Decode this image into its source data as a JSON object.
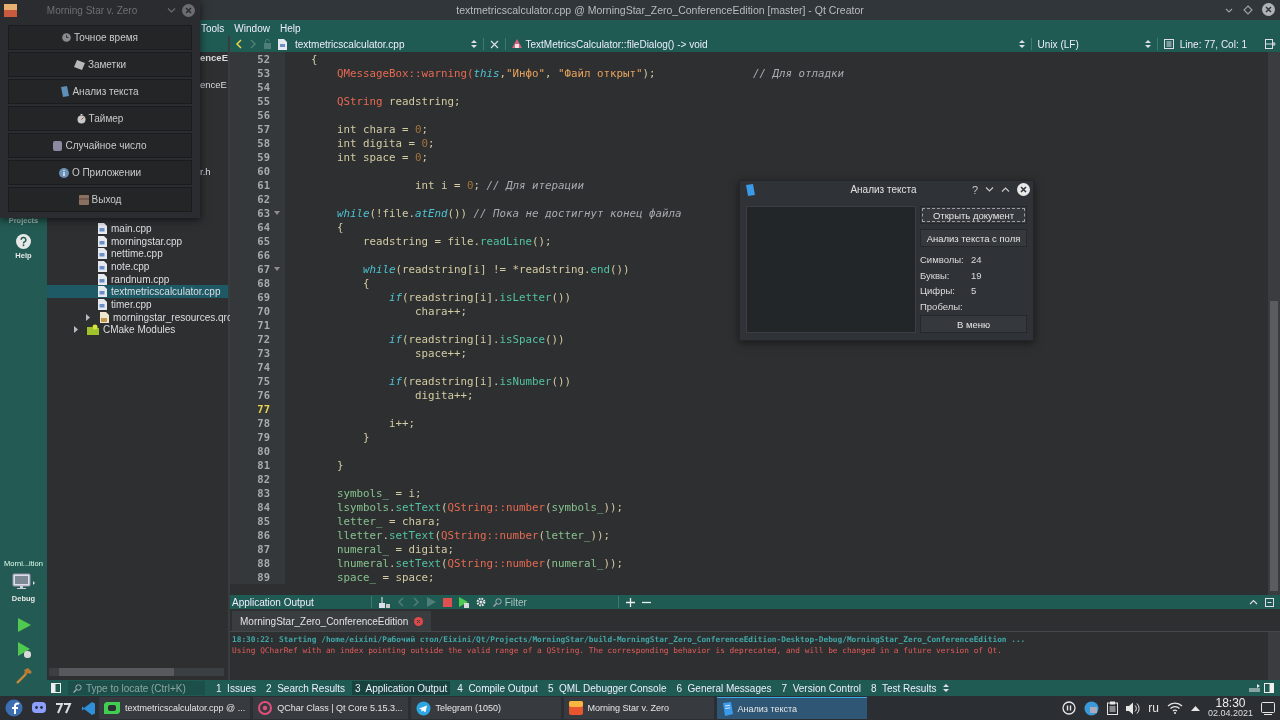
{
  "qt_window": {
    "title": "textmetricscalculator.cpp @ MorningStar_Zero_ConferenceEdition [master] - Qt Creator",
    "menu": [
      {
        "label": "Tools"
      },
      {
        "label": "Window"
      },
      {
        "label": "Help"
      }
    ]
  },
  "editor_toolbar": {
    "file": "textmetricscalculator.cpp",
    "symbol": "TextMetricsCalculator::fileDialog() -> void",
    "line_ending": "Unix (LF)",
    "position": "Line: 77, Col: 1"
  },
  "mode_bar": {
    "modes": [
      {
        "label": "Projects",
        "kind": "projects"
      },
      {
        "label": "Help",
        "kind": "help"
      }
    ],
    "project": "Morni...ition",
    "build": "Debug"
  },
  "project_tree": {
    "fragments": [
      {
        "text": "enceE",
        "kind": "project"
      },
      {
        "text": "enceE",
        "kind": "folder"
      },
      {
        "text": "r.h",
        "kind": "file"
      }
    ],
    "items": [
      {
        "label": "main.cpp",
        "kind": "file",
        "selected": false
      },
      {
        "label": "morningstar.cpp",
        "kind": "file",
        "selected": false
      },
      {
        "label": "nettime.cpp",
        "kind": "file",
        "selected": false
      },
      {
        "label": "note.cpp",
        "kind": "file",
        "selected": false
      },
      {
        "label": "randnum.cpp",
        "kind": "file",
        "selected": false
      },
      {
        "label": "textmetricscalculator.cpp",
        "kind": "file",
        "selected": true
      },
      {
        "label": "timer.cpp",
        "kind": "file",
        "selected": false
      },
      {
        "label": "morningstar_resources.qrc",
        "kind": "resource",
        "selected": false
      },
      {
        "label": "CMake Modules",
        "kind": "cmake",
        "selected": false
      }
    ]
  },
  "code": {
    "lines": [
      {
        "number": "52",
        "current": false,
        "foldable": false,
        "tokens": [
          {
            "kind": "plain",
            "text": "    {"
          }
        ]
      },
      {
        "number": "53",
        "current": false,
        "foldable": false,
        "tokens": [
          {
            "kind": "type",
            "text": "        QMessageBox::warning("
          },
          {
            "kind": "kw",
            "text": "this"
          },
          {
            "kind": "plain",
            "text": ","
          },
          {
            "kind": "str",
            "text": "\"Инфо\""
          },
          {
            "kind": "plain",
            "text": ", "
          },
          {
            "kind": "str",
            "text": "\"Файл открыт\""
          },
          {
            "kind": "plain",
            "text": ");               "
          },
          {
            "kind": "comment",
            "text": "// Для отладки"
          }
        ]
      },
      {
        "number": "54",
        "current": false,
        "foldable": false
      },
      {
        "number": "55",
        "current": false,
        "foldable": false,
        "tokens": [
          {
            "kind": "type",
            "text": "        QString"
          },
          {
            "kind": "plain",
            "text": " readstring;"
          }
        ]
      },
      {
        "number": "56",
        "current": false,
        "foldable": false
      },
      {
        "number": "57",
        "current": false,
        "foldable": false,
        "tokens": [
          {
            "kind": "plain",
            "text": "        int chara = "
          },
          {
            "kind": "num",
            "text": "0"
          },
          {
            "kind": "plain",
            "text": ";"
          }
        ]
      },
      {
        "number": "58",
        "current": false,
        "foldable": false,
        "tokens": [
          {
            "kind": "plain",
            "text": "        int digita = "
          },
          {
            "kind": "num",
            "text": "0"
          },
          {
            "kind": "plain",
            "text": ";"
          }
        ]
      },
      {
        "number": "59",
        "current": false,
        "foldable": false,
        "tokens": [
          {
            "kind": "plain",
            "text": "        int space = "
          },
          {
            "kind": "num",
            "text": "0"
          },
          {
            "kind": "plain",
            "text": ";"
          }
        ]
      },
      {
        "number": "60",
        "current": false,
        "foldable": false
      },
      {
        "number": "61",
        "current": false,
        "foldable": false,
        "tokens": [
          {
            "kind": "plain",
            "text": "                    int i = "
          },
          {
            "kind": "num",
            "text": "0"
          },
          {
            "kind": "plain",
            "text": "; "
          },
          {
            "kind": "comment",
            "text": "// Для итерации"
          }
        ]
      },
      {
        "number": "62",
        "current": false,
        "foldable": false
      },
      {
        "number": "63",
        "current": false,
        "foldable": true,
        "tokens": [
          {
            "kind": "kw",
            "text": "        while"
          },
          {
            "kind": "plain",
            "text": "(!file."
          },
          {
            "kind": "kw",
            "text": "atEnd"
          },
          {
            "kind": "plain",
            "text": "()) "
          },
          {
            "kind": "comment",
            "text": "// Пока не достигнут конец файла"
          }
        ]
      },
      {
        "number": "64",
        "current": false,
        "foldable": false,
        "tokens": [
          {
            "kind": "plain",
            "text": "        {"
          }
        ]
      },
      {
        "number": "65",
        "current": false,
        "foldable": false,
        "tokens": [
          {
            "kind": "plain",
            "text": "            readstring = file."
          },
          {
            "kind": "fn",
            "text": "readLine"
          },
          {
            "kind": "plain",
            "text": "();"
          }
        ]
      },
      {
        "number": "66",
        "current": false,
        "foldable": false
      },
      {
        "number": "67",
        "current": false,
        "foldable": true,
        "tokens": [
          {
            "kind": "kw",
            "text": "            while"
          },
          {
            "kind": "plain",
            "text": "(readstring[i] != *readstring."
          },
          {
            "kind": "fn",
            "text": "end"
          },
          {
            "kind": "plain",
            "text": "())"
          }
        ]
      },
      {
        "number": "68",
        "current": false,
        "foldable": false,
        "tokens": [
          {
            "kind": "plain",
            "text": "            {"
          }
        ]
      },
      {
        "number": "69",
        "current": false,
        "foldable": false,
        "tokens": [
          {
            "kind": "kw",
            "text": "                if"
          },
          {
            "kind": "plain",
            "text": "(readstring[i]."
          },
          {
            "kind": "fn",
            "text": "isLetter"
          },
          {
            "kind": "plain",
            "text": "())"
          }
        ]
      },
      {
        "number": "70",
        "current": false,
        "foldable": false,
        "tokens": [
          {
            "kind": "plain",
            "text": "                    chara++;"
          }
        ]
      },
      {
        "number": "71",
        "current": false,
        "foldable": false
      },
      {
        "number": "72",
        "current": false,
        "foldable": false,
        "tokens": [
          {
            "kind": "kw",
            "text": "                if"
          },
          {
            "kind": "plain",
            "text": "(readstring[i]."
          },
          {
            "kind": "fn",
            "text": "isSpace"
          },
          {
            "kind": "plain",
            "text": "())"
          }
        ]
      },
      {
        "number": "73",
        "current": false,
        "foldable": false,
        "tokens": [
          {
            "kind": "plain",
            "text": "                    space++;"
          }
        ]
      },
      {
        "number": "74",
        "current": false,
        "foldable": false
      },
      {
        "number": "75",
        "current": false,
        "foldable": false,
        "tokens": [
          {
            "kind": "kw",
            "text": "                if"
          },
          {
            "kind": "plain",
            "text": "(readstring[i]."
          },
          {
            "kind": "fn",
            "text": "isNumber"
          },
          {
            "kind": "plain",
            "text": "())"
          }
        ]
      },
      {
        "number": "76",
        "current": false,
        "foldable": false,
        "tokens": [
          {
            "kind": "plain",
            "text": "                    digita++;"
          }
        ]
      },
      {
        "number": "77",
        "current": true,
        "foldable": false
      },
      {
        "number": "78",
        "current": false,
        "foldable": false,
        "tokens": [
          {
            "kind": "plain",
            "text": "                i++;"
          }
        ]
      },
      {
        "number": "79",
        "current": false,
        "foldable": false,
        "tokens": [
          {
            "kind": "plain",
            "text": "            }"
          }
        ]
      },
      {
        "number": "80",
        "current": false,
        "foldable": false
      },
      {
        "number": "81",
        "current": false,
        "foldable": false,
        "tokens": [
          {
            "kind": "plain",
            "text": "        }"
          }
        ]
      },
      {
        "number": "82",
        "current": false,
        "foldable": false
      },
      {
        "number": "83",
        "current": false,
        "foldable": false,
        "tokens": [
          {
            "kind": "member",
            "text": "        symbols_"
          },
          {
            "kind": "plain",
            "text": " = i;"
          }
        ]
      },
      {
        "number": "84",
        "current": false,
        "foldable": false,
        "tokens": [
          {
            "kind": "member",
            "text": "        lsymbols"
          },
          {
            "kind": "plain",
            "text": "."
          },
          {
            "kind": "fn",
            "text": "setText"
          },
          {
            "kind": "plain",
            "text": "("
          },
          {
            "kind": "type",
            "text": "QString::number"
          },
          {
            "kind": "plain",
            "text": "("
          },
          {
            "kind": "member",
            "text": "symbols_"
          },
          {
            "kind": "plain",
            "text": "));"
          }
        ]
      },
      {
        "number": "85",
        "current": false,
        "foldable": false,
        "tokens": [
          {
            "kind": "member",
            "text": "        letter_"
          },
          {
            "kind": "plain",
            "text": " = chara;"
          }
        ]
      },
      {
        "number": "86",
        "current": false,
        "foldable": false,
        "tokens": [
          {
            "kind": "member",
            "text": "        lletter"
          },
          {
            "kind": "plain",
            "text": "."
          },
          {
            "kind": "fn",
            "text": "setText"
          },
          {
            "kind": "plain",
            "text": "("
          },
          {
            "kind": "type",
            "text": "QString::number"
          },
          {
            "kind": "plain",
            "text": "("
          },
          {
            "kind": "member",
            "text": "letter_"
          },
          {
            "kind": "plain",
            "text": "));"
          }
        ]
      },
      {
        "number": "87",
        "current": false,
        "foldable": false,
        "tokens": [
          {
            "kind": "member",
            "text": "        numeral_"
          },
          {
            "kind": "plain",
            "text": " = digita;"
          }
        ]
      },
      {
        "number": "88",
        "current": false,
        "foldable": false,
        "tokens": [
          {
            "kind": "member",
            "text": "        lnumeral"
          },
          {
            "kind": "plain",
            "text": "."
          },
          {
            "kind": "fn",
            "text": "setText"
          },
          {
            "kind": "plain",
            "text": "("
          },
          {
            "kind": "type",
            "text": "QString::number"
          },
          {
            "kind": "plain",
            "text": "("
          },
          {
            "kind": "member",
            "text": "numeral_"
          },
          {
            "kind": "plain",
            "text": "));"
          }
        ]
      },
      {
        "number": "89",
        "current": false,
        "foldable": false,
        "tokens": [
          {
            "kind": "member",
            "text": "        space_"
          },
          {
            "kind": "plain",
            "text": " = space;"
          }
        ]
      }
    ]
  },
  "output": {
    "title": "Application Output",
    "filter_placeholder": "Filter",
    "tab": "MorningStar_Zero_ConferenceEdition",
    "messages": [
      {
        "kind": "info",
        "text": "18:30:22: Starting /home/eixini/Рабочий стол/Eixini/Qt/Projects/MorningStar/build-MorningStar_Zero_ConferenceEdition-Desktop-Debug/MorningStar_Zero_ConferenceEdition ..."
      },
      {
        "kind": "error",
        "text": "Using QCharRef with an index pointing outside the valid range of a QString. The corresponding behavior is deprecated, and will be changed in a future version of Qt."
      }
    ]
  },
  "bottom_bar": {
    "locate_placeholder": "Type to locate (Ctrl+K)",
    "panes": [
      {
        "number": "1",
        "label": "Issues",
        "selected": false
      },
      {
        "number": "2",
        "label": "Search Results",
        "selected": false
      },
      {
        "number": "3",
        "label": "Application Output",
        "selected": true
      },
      {
        "number": "4",
        "label": "Compile Output",
        "selected": false
      },
      {
        "number": "5",
        "label": "QML Debugger Console",
        "selected": false
      },
      {
        "number": "6",
        "label": "General Messages",
        "selected": false
      },
      {
        "number": "7",
        "label": "Version Control",
        "selected": false
      },
      {
        "number": "8",
        "label": "Test Results",
        "selected": false
      }
    ]
  },
  "taskbar": {
    "tasks": [
      {
        "label": "textmetricscalculator.cpp @ ...",
        "kind": "qt",
        "selected": false
      },
      {
        "label": "QChar Class | Qt Core 5.15.3...",
        "kind": "browser",
        "selected": false
      },
      {
        "label": "Telegram (1050)",
        "kind": "telegram",
        "selected": false
      },
      {
        "label": "Morning Star v. Zero",
        "kind": "app",
        "selected": false
      },
      {
        "label": "Анализ текста",
        "kind": "doc",
        "selected": true
      }
    ],
    "language": "ru",
    "time": "18:30",
    "date": "02.04.2021"
  },
  "menu_window": {
    "title": "Morning Star v. Zero",
    "active": false,
    "buttons": [
      {
        "label": "Точное время",
        "kind": "clock"
      },
      {
        "label": "Заметки",
        "kind": "note"
      },
      {
        "label": "Анализ текста",
        "kind": "doc"
      },
      {
        "label": "Таймер",
        "kind": "timer"
      },
      {
        "label": "Случайное число",
        "kind": "dice"
      },
      {
        "label": "О Приложении",
        "kind": "info"
      },
      {
        "label": "Выход",
        "kind": "exit"
      }
    ]
  },
  "dialog": {
    "title": "Анализ текста",
    "help": "?",
    "actions": [
      {
        "label": "Открыть документ",
        "focused": true
      },
      {
        "label": "Анализ текста с поля",
        "focused": false
      }
    ],
    "stats": [
      {
        "label": "Символы:",
        "value": "24"
      },
      {
        "label": "Буквы:",
        "value": "19"
      },
      {
        "label": "Цифры:",
        "value": "5"
      },
      {
        "label": "Пробелы:"
      }
    ],
    "menu_button": "В меню"
  }
}
